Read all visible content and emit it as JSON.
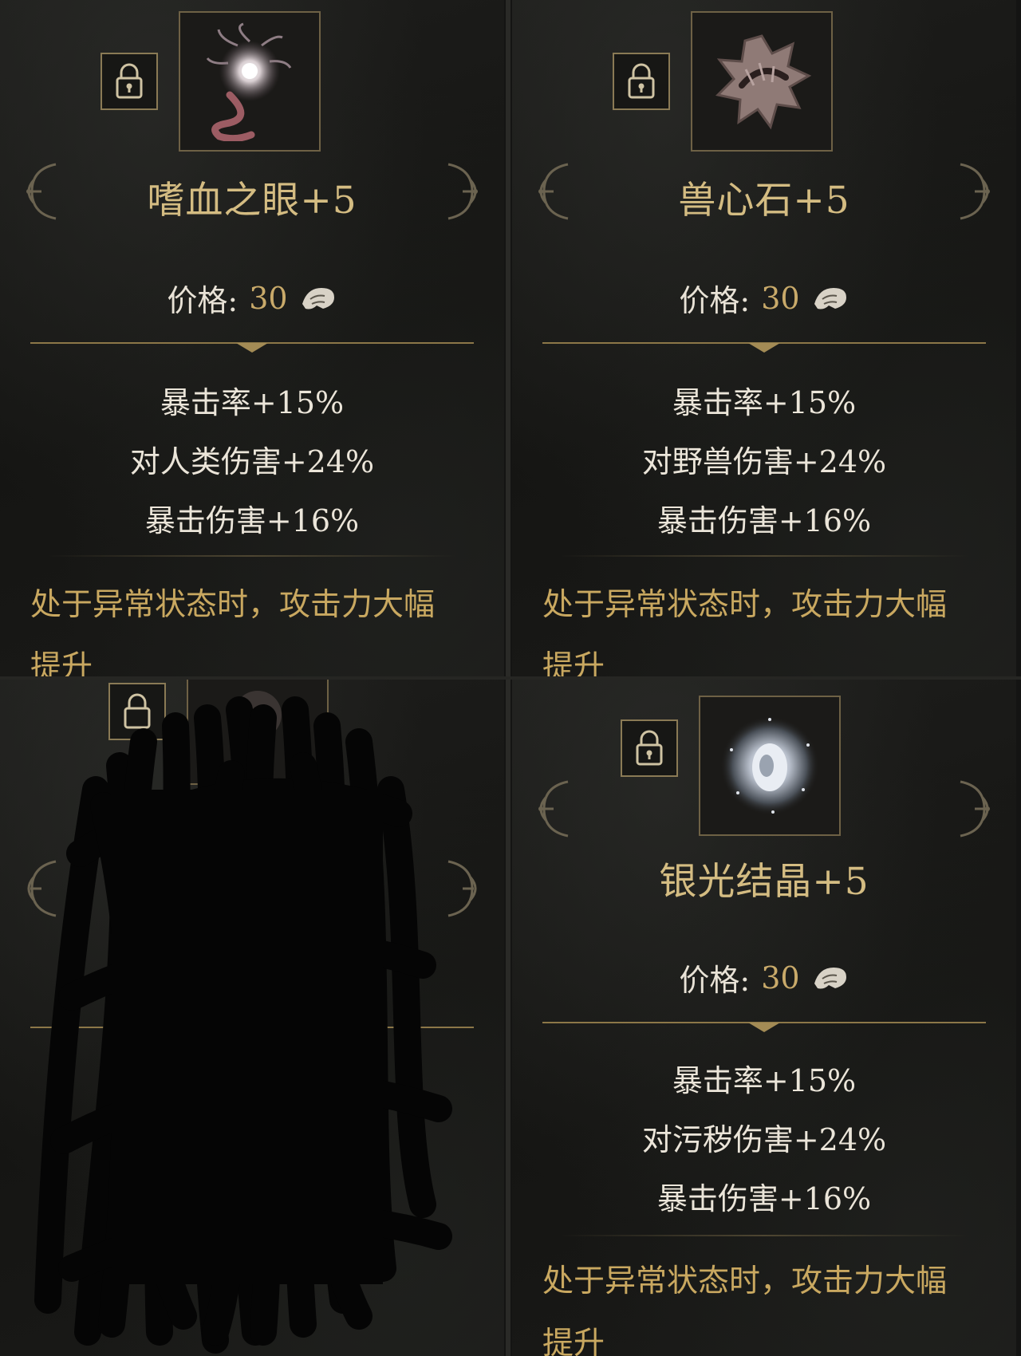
{
  "price_label": "价格:",
  "cards": [
    {
      "item_name": "嗜血之眼+5",
      "price": "30",
      "stats": [
        "暴击率+15%",
        "对人类伤害+24%",
        "暴击伤害+16%"
      ],
      "desc_line1": "处于异常状态时，攻击力大幅",
      "desc_line2": "提升",
      "icon": "eye-tentacle-icon"
    },
    {
      "item_name": "兽心石+5",
      "price": "30",
      "stats": [
        "暴击率+15%",
        "对野兽伤害+24%",
        "暴击伤害+16%"
      ],
      "desc_line1": "处于异常状态时，攻击力大幅",
      "desc_line2": "提升",
      "icon": "beast-heart-stone-icon"
    },
    {
      "redacted": true,
      "icon": "redacted-item-icon"
    },
    {
      "item_name": "银光结晶+5",
      "price": "30",
      "stats": [
        "暴击率+15%",
        "对污秽伤害+24%",
        "暴击伤害+16%"
      ],
      "desc_line1": "处于异常状态时，攻击力大幅",
      "desc_line2": "提升",
      "icon": "silver-crystal-icon"
    }
  ],
  "colors": {
    "name_gold": "#d4bc82",
    "price_gold": "#c9aa6a",
    "desc_gold": "#c9a860",
    "stat_text": "#ebe5d9",
    "border_gold": "#8a7a55"
  }
}
